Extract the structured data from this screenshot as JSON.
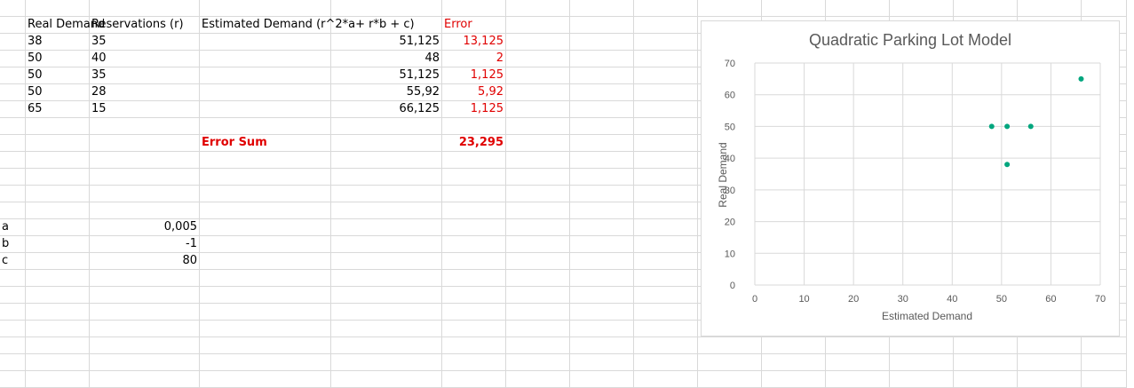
{
  "headers": {
    "real_demand": "Real Demand",
    "reservations": "Reservations (r)",
    "estimated": "Estimated Demand (r^2*a+ r*b + c)",
    "error": "Error"
  },
  "rows": [
    {
      "real": "38",
      "res": "35",
      "est": "51,125",
      "err": "13,125"
    },
    {
      "real": "50",
      "res": "40",
      "est": "48",
      "err": "2"
    },
    {
      "real": "50",
      "res": "35",
      "est": "51,125",
      "err": "1,125"
    },
    {
      "real": "50",
      "res": "28",
      "est": "55,92",
      "err": "5,92"
    },
    {
      "real": "65",
      "res": "15",
      "est": "66,125",
      "err": "1,125"
    }
  ],
  "error_sum": {
    "label": "Error Sum",
    "value": "23,295"
  },
  "params": [
    {
      "name": "a",
      "value": "0,005"
    },
    {
      "name": "b",
      "value": "-1"
    },
    {
      "name": "c",
      "value": "80"
    }
  ],
  "colors": {
    "error_red": "#e00000",
    "marker": "#00a67e",
    "grid": "#d9d9d9"
  },
  "chart_data": {
    "type": "scatter",
    "title": "Quadratic Parking Lot Model",
    "xlabel": "Estimated Demand",
    "ylabel": "Real Demand",
    "xlim": [
      0,
      70
    ],
    "ylim": [
      0,
      70
    ],
    "xticks": [
      "0",
      "10",
      "20",
      "30",
      "40",
      "50",
      "60",
      "70"
    ],
    "yticks": [
      "0",
      "10",
      "20",
      "30",
      "40",
      "50",
      "60",
      "70"
    ],
    "grid": true,
    "series": [
      {
        "x": [
          51.125,
          48,
          51.125,
          55.92,
          66.125
        ],
        "y": [
          38,
          50,
          50,
          50,
          65
        ]
      }
    ]
  }
}
